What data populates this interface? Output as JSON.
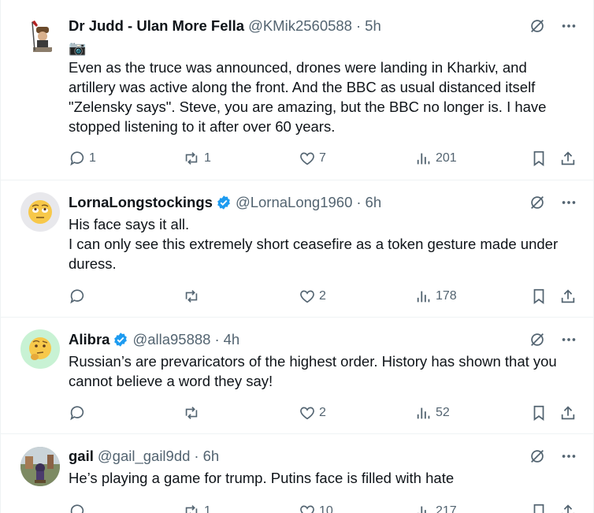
{
  "tweets": [
    {
      "name": "Dr Judd - Ulan More Fella",
      "handle": "@KMik2560588",
      "time": "5h",
      "verified": false,
      "emoji": "📷",
      "lines": [
        "Even as the truce was announced, drones were landing in Kharkiv, and",
        "artillery was active along the front.  And the BBC as usual distanced itself",
        "\"Zelensky says\".  Steve, you are amazing, but the BBC no longer is. I have",
        "stopped listening to it after over 60 years."
      ],
      "replies": "1",
      "reposts": "1",
      "likes": "7",
      "views": "201"
    },
    {
      "name": "LornaLongstockings",
      "handle": "@LornaLong1960",
      "time": "6h",
      "verified": true,
      "avatar_emoji": "🙄",
      "lines": [
        "His face says it all.",
        "I can only see this extremely short ceasefire as a token gesture made under",
        "duress."
      ],
      "replies": "",
      "reposts": "",
      "likes": "2",
      "views": "178"
    },
    {
      "name": "Alibra",
      "handle": "@alla95888",
      "time": "4h",
      "verified": true,
      "avatar_emoji": "🤔",
      "lines": [
        "Russian’s are prevaricators of the highest order. History has shown that you",
        "cannot believe a word they say!"
      ],
      "replies": "",
      "reposts": "",
      "likes": "2",
      "views": "52"
    },
    {
      "name": "gail",
      "handle": "@gail_gail9dd",
      "time": "6h",
      "verified": false,
      "lines": [
        "He’s playing a game for trump. Putins face is filled with hate"
      ],
      "replies": "",
      "reposts": "1",
      "likes": "10",
      "views": "217"
    }
  ],
  "separator": "·",
  "colors": {
    "text": "#0f1419",
    "muted": "#536471",
    "verified": "#1d9bf0",
    "border": "#eff3f4"
  }
}
